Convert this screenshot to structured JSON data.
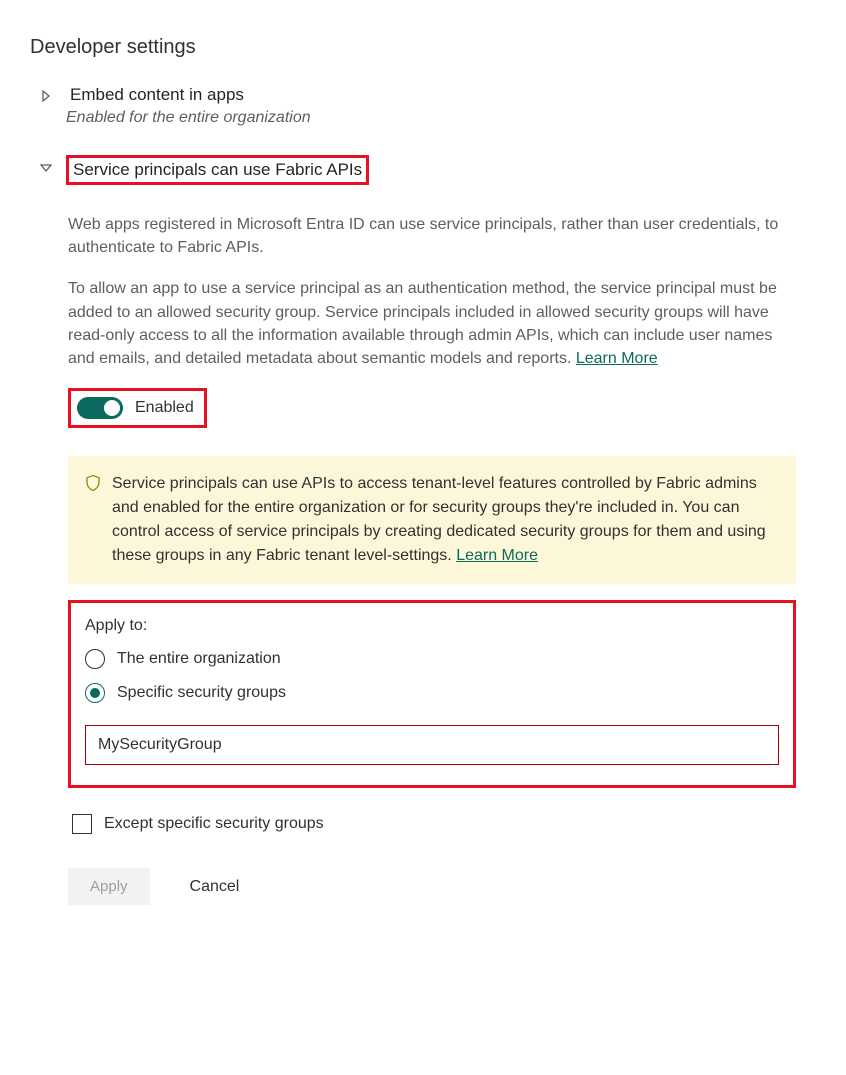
{
  "section_title": "Developer settings",
  "settings": {
    "embed": {
      "title": "Embed content in apps",
      "subtitle": "Enabled for the entire organization"
    },
    "service_principals": {
      "title": "Service principals can use Fabric APIs",
      "para1": "Web apps registered in Microsoft Entra ID can use service principals, rather than user credentials, to authenticate to Fabric APIs.",
      "para2": "To allow an app to use a service principal as an authentication method, the service principal must be added to an allowed security group. Service principals included in allowed security groups will have read-only access to all the information available through admin APIs, which can include user names and emails, and detailed metadata about semantic models and reports.  ",
      "learn_more": "Learn More",
      "toggle_label": "Enabled",
      "notice": "Service principals can use APIs to access tenant-level features controlled by Fabric admins and enabled for the entire organization or for security groups they're included in. You can control access of service principals by creating dedicated security groups for them and using these groups in any Fabric tenant level-settings.  ",
      "notice_learn_more": "Learn More",
      "apply_to_label": "Apply to:",
      "radio_entire": "The entire organization",
      "radio_specific": "Specific security groups",
      "input_value": "MySecurityGroup",
      "except_label": "Except specific security groups",
      "btn_apply": "Apply",
      "btn_cancel": "Cancel"
    }
  }
}
